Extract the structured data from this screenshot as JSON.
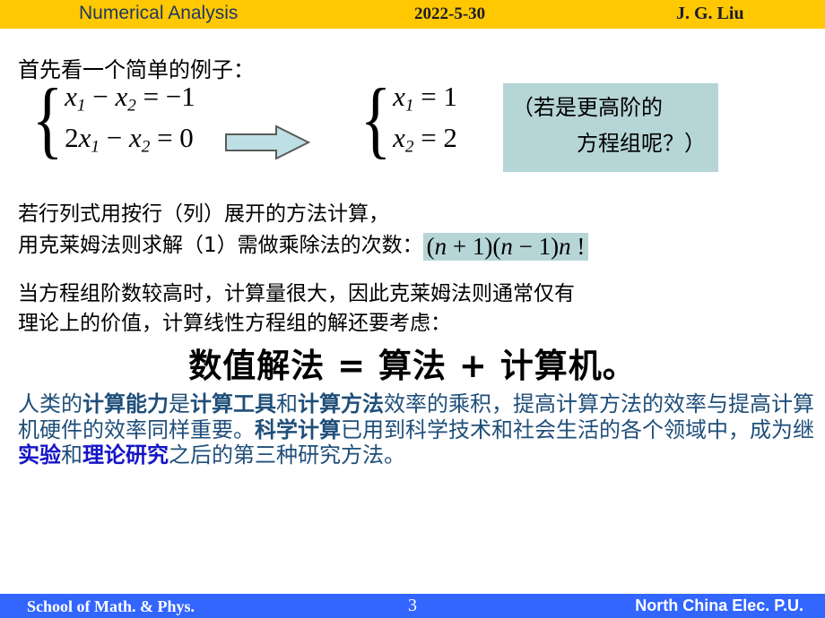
{
  "header": {
    "title": "Numerical Analysis",
    "date": "2022-5-30",
    "author": "J. G. Liu",
    "bg_color": "#FFC800",
    "text_color": "#1F3864"
  },
  "slide": {
    "intro_line": "首先看一个简单的例子：",
    "equations": {
      "left_system": [
        {
          "lhs_a": "x",
          "sub_a": "1",
          "op1": " − ",
          "lhs_b": "x",
          "sub_b": "2",
          "eq": " = ",
          "rhs": "−1",
          "plain": "x1 − x2 = −1"
        },
        {
          "coef": "2",
          "lhs_a": "x",
          "sub_a": "1",
          "op1": " − ",
          "lhs_b": "x",
          "sub_b": "2",
          "eq": " = ",
          "rhs": "0",
          "plain": "2x1 − x2 = 0"
        }
      ],
      "right_system": [
        {
          "lhs_a": "x",
          "sub_a": "1",
          "eq": " = ",
          "rhs": "1",
          "plain": "x1 = 1"
        },
        {
          "lhs_a": "x",
          "sub_a": "2",
          "eq": " = ",
          "rhs": "2",
          "plain": "x2 = 2"
        }
      ],
      "arrow_icon": "right-block-arrow",
      "arrow_fill": "#BEE0E4",
      "arrow_stroke": "#5A5A5A"
    },
    "callout": {
      "line1": "（若是更高阶的",
      "line2": "方程组呢？）",
      "bg_color": "#B6D5D6"
    },
    "mid_line_1": "若行列式用按行（列）展开的方法计算，",
    "mid_line_2_prefix": "用克莱姆法则求解（1）需做乘除法的次数：",
    "formula_highlight": {
      "text": "(n+1)(n−1)n!",
      "bg_color": "#B6D5D6"
    },
    "paragraph_line_1": "当方程组阶数较高时，计算量很大，因此克莱姆法则通常仅有",
    "paragraph_line_2": "理论上的价值，计算线性方程组的解还要考虑：",
    "headline": "数值解法 = 算法 + 计算机。",
    "blue_paragraph": {
      "text_color": "#1F4E79",
      "accent_color": "#1414C8",
      "seg_1": "人类的",
      "seg_2_bold": "计算能力",
      "seg_3": "是",
      "seg_4_bold": "计算工具",
      "seg_5": "和",
      "seg_6_bold": "计算方法",
      "seg_7": "效率的乘积，提高计算方法的效率与提高计算机硬件的效率同样重要。",
      "seg_8_bold": "科学计算",
      "seg_9": "已用到科学技术和社会生活的各个领域中，成为继",
      "seg_10_accent": "实验",
      "seg_11": "和",
      "seg_12_accent": "理论研究",
      "seg_13": "之后的第三种研究方法。"
    }
  },
  "footer": {
    "left": "School of Math. & Phys.",
    "page_number": "3",
    "right": "North China Elec. P.U.",
    "bg_color": "#3366FF",
    "text_color": "#FFFFFF"
  }
}
